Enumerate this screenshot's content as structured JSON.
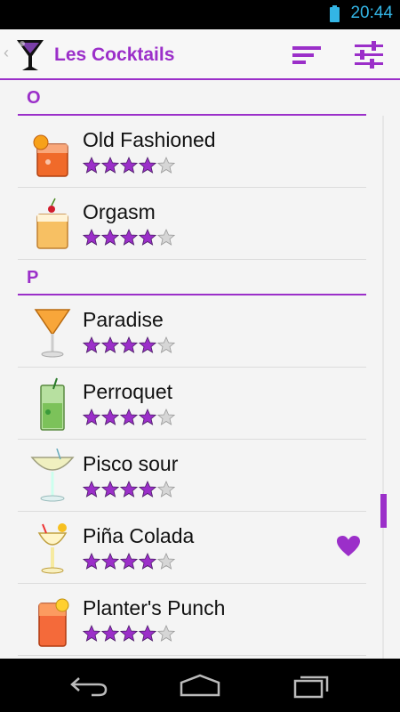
{
  "status_bar": {
    "time": "20:44",
    "battery_icon": "battery-icon"
  },
  "action_bar": {
    "title": "Les Cocktails",
    "up_glyph": "‹",
    "sort_icon": "sort-icon",
    "filter_icon": "sliders-icon",
    "accent_color": "#9b2fc9"
  },
  "sections": [
    {
      "letter": "O",
      "items": [
        {
          "name": "Old Fashioned",
          "rating": 4,
          "max_rating": 5,
          "favorite": false,
          "icon": "old-fashioned-glass-icon"
        },
        {
          "name": "Orgasm",
          "rating": 4,
          "max_rating": 5,
          "favorite": false,
          "icon": "orgasm-glass-icon"
        }
      ]
    },
    {
      "letter": "P",
      "items": [
        {
          "name": "Paradise",
          "rating": 4,
          "max_rating": 5,
          "favorite": false,
          "icon": "paradise-glass-icon"
        },
        {
          "name": "Perroquet",
          "rating": 4,
          "max_rating": 5,
          "favorite": false,
          "icon": "perroquet-glass-icon"
        },
        {
          "name": "Pisco sour",
          "rating": 4,
          "max_rating": 5,
          "favorite": false,
          "icon": "pisco-sour-glass-icon"
        },
        {
          "name": "Piña Colada",
          "rating": 4,
          "max_rating": 5,
          "favorite": true,
          "icon": "pina-colada-glass-icon"
        },
        {
          "name": "Planter's Punch",
          "rating": 4,
          "max_rating": 5,
          "favorite": false,
          "icon": "planters-punch-glass-icon"
        }
      ]
    }
  ],
  "nav_bar": {
    "back_icon": "back-icon",
    "home_icon": "home-icon",
    "recents_icon": "recents-icon"
  }
}
